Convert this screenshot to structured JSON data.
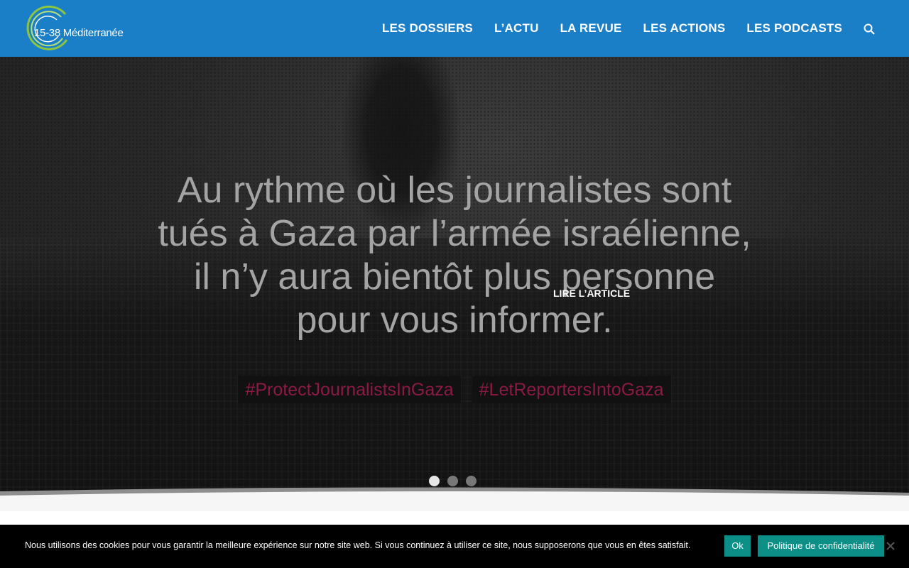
{
  "header": {
    "logo_text": "15-38 Méditerranée",
    "nav": [
      {
        "label": "LES DOSSIERS"
      },
      {
        "label": "L’ACTU"
      },
      {
        "label": "LA REVUE"
      },
      {
        "label": "LES ACTIONS"
      },
      {
        "label": "LES PODCASTS"
      }
    ],
    "search_icon": "search-icon"
  },
  "hero": {
    "headline_lines": [
      "Au rythme où les journalistes sont",
      "tués à Gaza par l’armée israélienne,",
      "il n’y aura bientôt plus personne",
      "pour vous informer."
    ],
    "hashtags": [
      "#ProtectJournalistsInGaza",
      "#LetReportersIntoGaza"
    ],
    "cta_label": "LIRE L’ARTICLE",
    "slides_count": 3,
    "active_slide": 1
  },
  "cookie_bar": {
    "message": "Nous utilisons des cookies pour vous garantir la meilleure expérience sur notre site web. Si vous continuez à utiliser ce site, nous supposerons que vous en êtes satisfait.",
    "ok_label": "Ok",
    "policy_label": "Politique de confidentialité",
    "close_icon": "close-icon"
  },
  "colors": {
    "header_bg": "#1a7fc7",
    "logo_accent": "#8cc63f",
    "hashtag": "#8a1a44",
    "cookie_button": "#0b8f87"
  }
}
